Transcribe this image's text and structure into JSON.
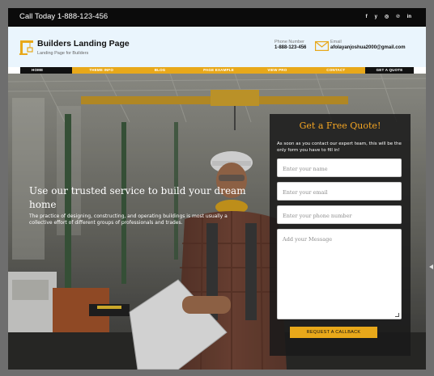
{
  "topbar": {
    "call_text": "Call Today 1-888-123-456",
    "social_icons": [
      {
        "name": "facebook-icon",
        "glyph": "f"
      },
      {
        "name": "twitter-icon",
        "glyph": "y"
      },
      {
        "name": "instagram-icon",
        "glyph": "◎"
      },
      {
        "name": "pinterest-icon",
        "glyph": "℗"
      },
      {
        "name": "linkedin-icon",
        "glyph": "in"
      }
    ]
  },
  "header": {
    "title": "Builders Landing Page",
    "tagline": "Landing Page for Builders",
    "phone_label": "Phone Number",
    "phone_value": "1-888-123-456",
    "email_label": "Email",
    "email_value": "afolayanjoshua2000@gmail.com"
  },
  "nav": {
    "items": [
      "HOME",
      "THEME INFO",
      "BLOG",
      "PAGE EXAMPLE",
      "VIEW PRO",
      "CONTACT",
      "GET A QUOTE"
    ]
  },
  "hero": {
    "title": "Use our trusted service to build your dream home",
    "text": "The practice of designing, constructing, and operating buildings is most usually a collective effort of different groups of professionals and trades."
  },
  "form": {
    "title": "Get a Free Quote!",
    "subtitle": "As soon as you contact our expert team, this will be the only form you have to fill in!",
    "name_placeholder": "Enter your name",
    "email_placeholder": "Enter your email",
    "phone_placeholder": "Enter your phone number",
    "message_placeholder": "Add your Message",
    "button_label": "REQUEST A CALLBACK"
  },
  "colors": {
    "accent": "#e8a81a",
    "topbar": "#0b0b0b",
    "header_bg": "#eaf5fd",
    "form_title": "#f5a623"
  }
}
